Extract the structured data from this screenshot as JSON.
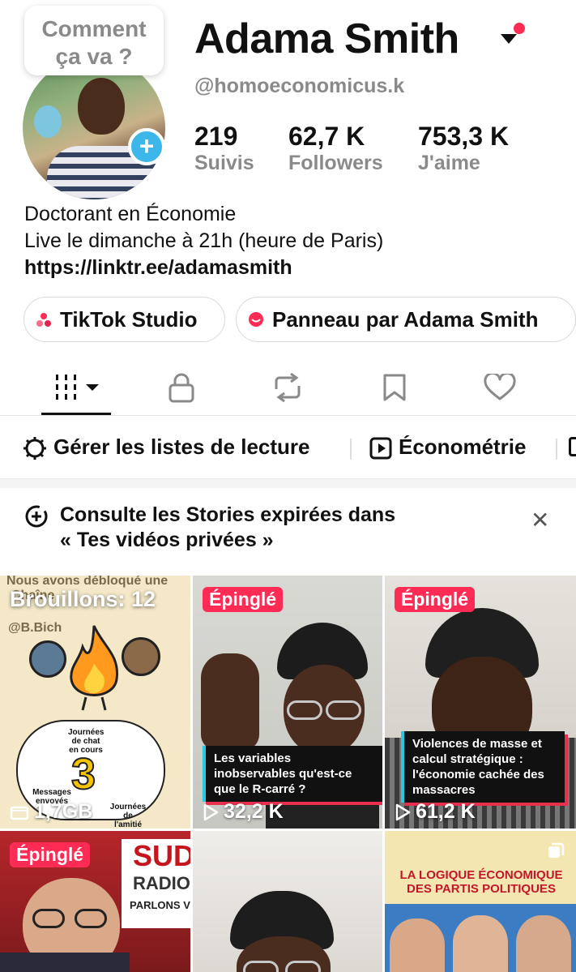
{
  "bubble": {
    "line1": "Comment",
    "line2": "ça va ?"
  },
  "profile": {
    "name": "Adama Smith",
    "handle": "@homoeconomicus.k",
    "stats": [
      {
        "value": "219",
        "label": "Suivis"
      },
      {
        "value": "62,7 K",
        "label": "Followers"
      },
      {
        "value": "753,3 K",
        "label": "J'aime"
      }
    ],
    "bio": [
      "Doctorant en Économie",
      "Live le dimanche à 21h (heure de Paris)"
    ],
    "link": "https://linktr.ee/adamasmith"
  },
  "buttons": {
    "studio": "TikTok Studio",
    "panel": "Panneau par Adama Smith"
  },
  "tabs": [
    {
      "icon": "grid-icon",
      "active": true
    },
    {
      "icon": "lock-icon"
    },
    {
      "icon": "repost-icon"
    },
    {
      "icon": "bookmark-icon"
    },
    {
      "icon": "heart-icon"
    }
  ],
  "playlists": {
    "manage": "Gérer les listes de lecture",
    "item": "Économétrie"
  },
  "notice": {
    "line1": "Consulte les Stories expirées dans",
    "line2": "« Tes vidéos privées »"
  },
  "grid": {
    "drafts": {
      "label": "Brouillons: 12",
      "size": "1,7GB",
      "overlay_top": "Nous avons débloqué une",
      "overlay_chain": "Chaîne",
      "overlay_handle": "@B.Bich",
      "days_label": "Journées de chat en cours",
      "days_count": "3",
      "msgs_label": "Messages envoyés",
      "friend_label": "Journées de l'amitié"
    },
    "videos": [
      {
        "badge": "Épinglé",
        "views": "32,2 K",
        "caption": "Les variables inobservables qu'est-ce que le R-carré ?"
      },
      {
        "badge": "Épinglé",
        "views": "61,2 K",
        "caption": "Violences de masse et calcul stratégique : l'économie cachée des massacres"
      },
      {
        "badge": "Épinglé",
        "brand1": "SUD",
        "brand2": "RADIO",
        "brand3": "PARLONS VRAI"
      },
      {},
      {
        "headline": "LA LOGIQUE ÉCONOMIQUE DES PARTIS POLITIQUES"
      }
    ]
  },
  "colors": {
    "accent": "#fe2c55",
    "follow_blue": "#3db7ea",
    "muted": "#8a8a8a"
  }
}
